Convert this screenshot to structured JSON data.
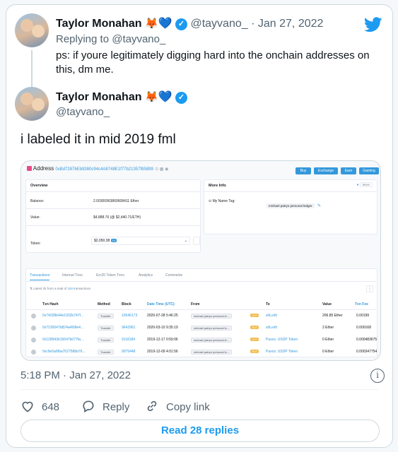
{
  "reply_tweet": {
    "display_name": "Taylor Monahan",
    "emojis": [
      "🦊",
      "💙"
    ],
    "handle": "@tayvano_",
    "separator": "·",
    "date": "Jan 27, 2022",
    "replying_to": "Replying to @tayvano_",
    "text": "ps: if youre legitimately digging hard into the onchain addresses on this, dm me."
  },
  "main_tweet": {
    "display_name": "Taylor Monahan",
    "handle": "@tayvano_",
    "text": "i labeled it in mid 2019 fml",
    "timestamp": "5:18 PM · Jan 27, 2022",
    "likes": "648",
    "reply_label": "Reply",
    "copy_link_label": "Copy link",
    "read_replies": "Read 28 replies"
  },
  "screenshot": {
    "title": "Address",
    "address": "0xBd72876Eb9380c94c4A8748E1f77b21357f85899",
    "buttons": [
      "Buy",
      "Exchange",
      "Earn",
      "Gaming"
    ],
    "overview": {
      "title": "Overview",
      "balance_label": "Balance:",
      "balance_value": "2.00300963860608411 Ether",
      "value_label": "Value:",
      "value_value": "$4,888.76 (@ $2,440.71/ETH)",
      "token_label": "Token:",
      "token_value": "$2,050.38",
      "token_count": "10"
    },
    "more_info": {
      "title": "More Info",
      "more_label": "More",
      "name_tag_label": "My Name Tag:",
      "name_tag_value": "michael patryn personal ledger"
    },
    "tabs": [
      "Transactions",
      "Internal Txns",
      "Erc20 Token Txns",
      "Analytics",
      "Comments"
    ],
    "summary_prefix": "Latest 25 from a total of",
    "summary_count": "119",
    "summary_suffix": "transactions",
    "columns": [
      "Txn Hash",
      "Method",
      "Block",
      "Date Time (UTC)",
      "From",
      "To",
      "Value",
      "Txn Fee"
    ],
    "rows": [
      {
        "hash": "0x74028b44e1932b747f...",
        "method": "Transfer",
        "block": "10546173",
        "date": "2020-07-28 5:46:25",
        "from": "michael patryn personal le...",
        "dir": "OUT",
        "to": "sifu.eth",
        "value": "206.85 Ether",
        "fee": "0.00199"
      },
      {
        "hash": "0x7230047b824a499fe4...",
        "method": "Transfer",
        "block": "9642961",
        "date": "2020-03-10 9:35:19",
        "from": "michael patryn personal le...",
        "dir": "OUT",
        "to": "sifu.eth",
        "value": "2 Ether",
        "fee": "0.000168"
      },
      {
        "hash": "0x128943b15647b077fa...",
        "method": "Transfer",
        "block": "9118184",
        "date": "2019-12-17 0:59:06",
        "from": "michael patryn personal le...",
        "dir": "OUT",
        "to": "Paxos: USDP Token",
        "value": "0 Ether",
        "fee": "0.000483675"
      },
      {
        "hash": "0xc9e5a6fba702758bb76...",
        "method": "Transfer",
        "block": "9075448",
        "date": "2019-12-09 4:01:56",
        "from": "michael patryn personal le...",
        "dir": "OUT",
        "to": "Paxos: USDP Token",
        "value": "0 Ether",
        "fee": "0.000347754"
      }
    ]
  },
  "icons": {
    "brand": "twitter-bird-icon",
    "verified": "verified-badge-icon",
    "like": "heart-outline-icon",
    "reply": "speech-bubble-icon",
    "copy_link": "chain-link-icon",
    "info": "info-circle-icon"
  },
  "colors": {
    "twitter_blue": "#1d9bf0",
    "etherscan_blue": "#3498db",
    "text_grey": "#536471"
  }
}
